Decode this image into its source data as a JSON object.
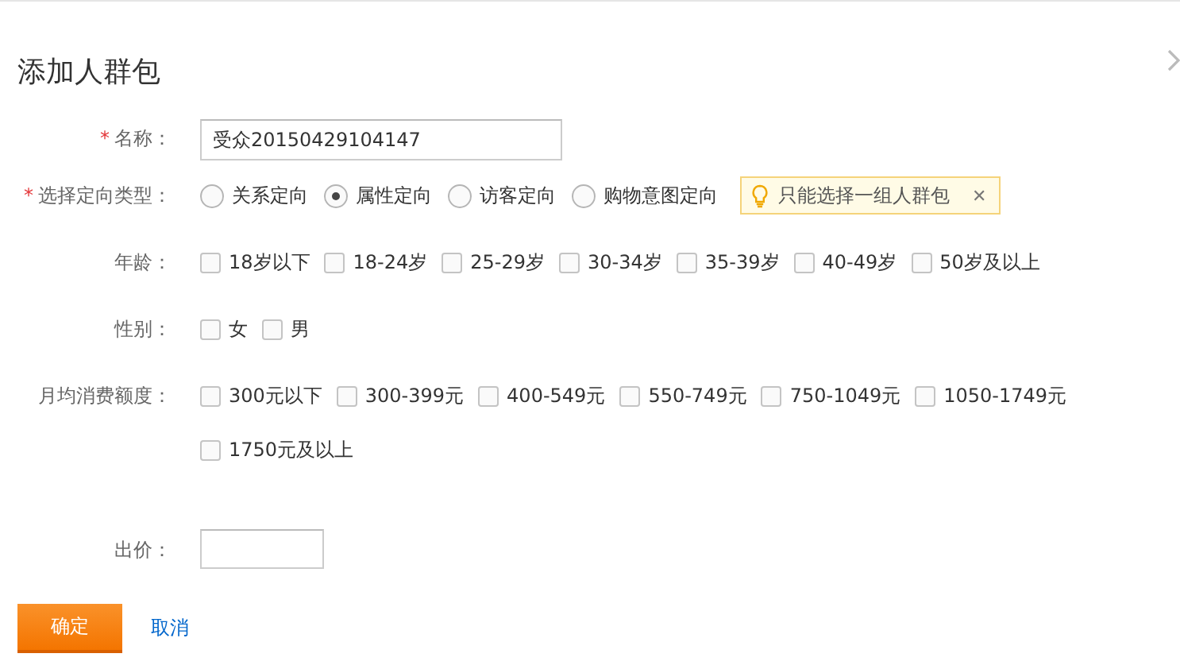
{
  "dialog": {
    "title": "添加人群包"
  },
  "name_field": {
    "mark": "*",
    "label": "名称：",
    "value": "受众20150429104147"
  },
  "targeting": {
    "mark": "*",
    "label": "选择定向类型：",
    "options": [
      {
        "label": "关系定向",
        "selected": false
      },
      {
        "label": "属性定向",
        "selected": true
      },
      {
        "label": "访客定向",
        "selected": false
      },
      {
        "label": "购物意图定向",
        "selected": false
      }
    ],
    "tip": {
      "text": "只能选择一组人群包",
      "close": "✕"
    }
  },
  "groups": [
    {
      "label": "年龄：",
      "options": [
        {
          "label": "18岁以下",
          "checked": false
        },
        {
          "label": "18-24岁",
          "checked": false
        },
        {
          "label": "25-29岁",
          "checked": false
        },
        {
          "label": "30-34岁",
          "checked": false
        },
        {
          "label": "35-39岁",
          "checked": false
        },
        {
          "label": "40-49岁",
          "checked": false
        },
        {
          "label": "50岁及以上",
          "checked": false
        }
      ]
    },
    {
      "label": "性别：",
      "options": [
        {
          "label": "女",
          "checked": false
        },
        {
          "label": "男",
          "checked": false
        }
      ]
    },
    {
      "label": "月均消费额度：",
      "options": [
        {
          "label": "300元以下",
          "checked": false
        },
        {
          "label": "300-399元",
          "checked": false
        },
        {
          "label": "400-549元",
          "checked": false
        },
        {
          "label": "550-749元",
          "checked": false
        },
        {
          "label": "750-1049元",
          "checked": false
        },
        {
          "label": "1050-1749元",
          "checked": false
        },
        {
          "label": "1750元及以上",
          "checked": false
        }
      ]
    }
  ],
  "price_field": {
    "label": "出价："
  },
  "buttons": {
    "confirm": "确定",
    "cancel": "取消"
  }
}
